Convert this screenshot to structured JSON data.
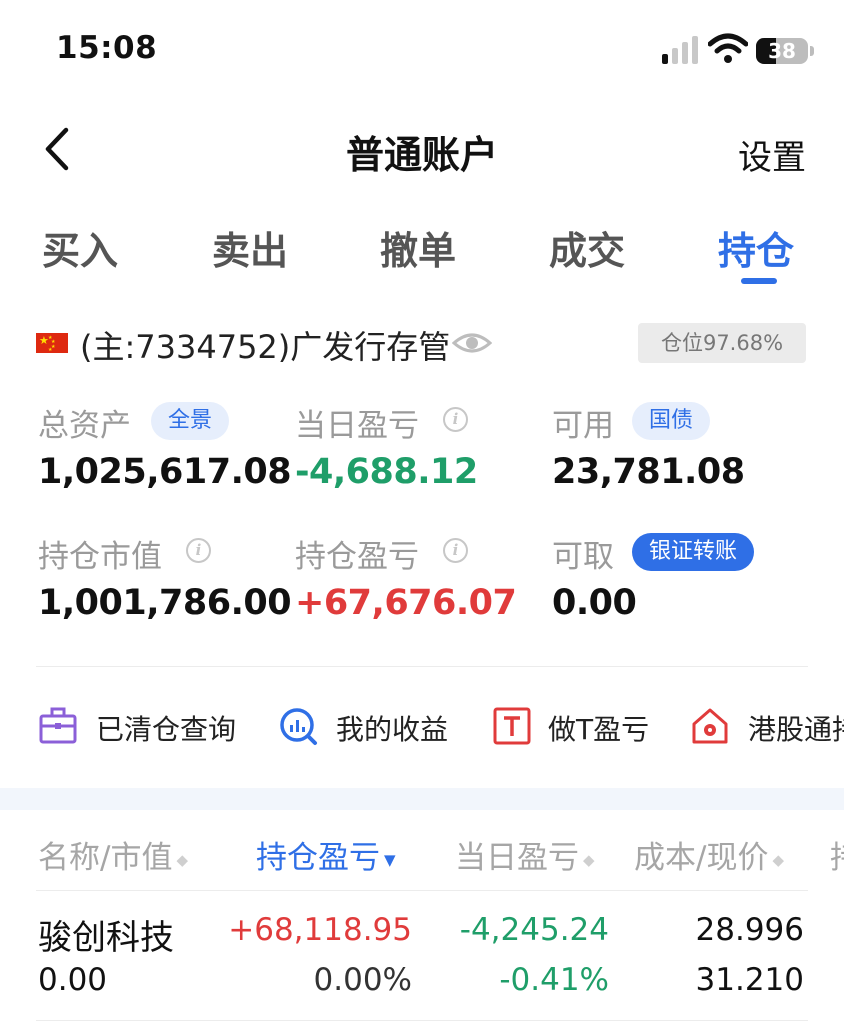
{
  "status": {
    "time": "15:08",
    "battery": "38",
    "battery_level": 0.38
  },
  "nav": {
    "title": "普通账户",
    "settings": "设置"
  },
  "tabs": [
    {
      "label": "买入"
    },
    {
      "label": "卖出"
    },
    {
      "label": "撤单"
    },
    {
      "label": "成交"
    },
    {
      "label": "持仓"
    }
  ],
  "account": {
    "name": "(主:7334752)广发行存管",
    "position": "仓位97.68%"
  },
  "stats": {
    "total_assets": {
      "label": "总资产",
      "tag": "全景",
      "value": "1,025,617.08"
    },
    "daily_pnl": {
      "label": "当日盈亏",
      "value": "-4,688.12"
    },
    "available": {
      "label": "可用",
      "tag": "国债",
      "value": "23,781.08"
    },
    "market_value": {
      "label": "持仓市值",
      "value": "1,001,786.00"
    },
    "position_pnl": {
      "label": "持仓盈亏",
      "value": "+67,676.07"
    },
    "withdrawable": {
      "label": "可取",
      "tag": "银证转账",
      "value": "0.00"
    }
  },
  "quick_actions": [
    {
      "label": "已清仓查询",
      "icon": "briefcase-icon"
    },
    {
      "label": "我的收益",
      "icon": "chart-search-icon"
    },
    {
      "label": "做T盈亏",
      "icon": "t-box-icon"
    },
    {
      "label": "港股通持",
      "icon": "hk-flower-icon"
    }
  ],
  "table": {
    "headers": [
      "名称/市值",
      "持仓盈亏",
      "当日盈亏",
      "成本/现价",
      "持"
    ],
    "rows": [
      {
        "name": "骏创科技",
        "market_value": "0.00",
        "position_pnl": "+68,118.95",
        "position_pnl_pct": "0.00%",
        "daily_pnl": "-4,245.24",
        "daily_pnl_pct": "-0.41%",
        "cost": "28.996",
        "price": "31.210"
      }
    ]
  },
  "colors": {
    "accent": "#2f6fe6",
    "up": "#e03b3b",
    "down": "#1f9e69"
  }
}
